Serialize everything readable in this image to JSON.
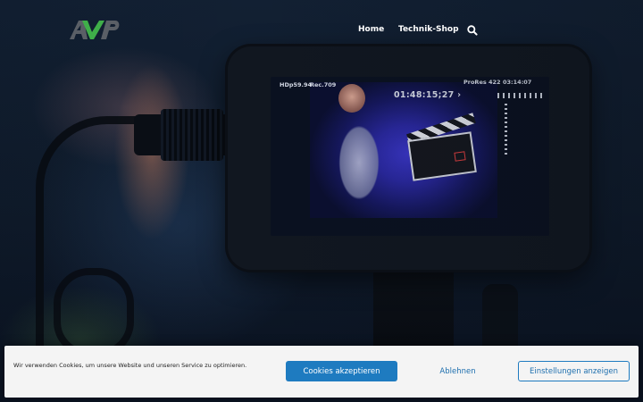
{
  "header": {
    "logo_text": "AVP",
    "logo_colors": {
      "a": "#5a5f66",
      "v": "#3fae49",
      "p": "#5a5f66"
    },
    "nav": [
      {
        "label": "Home"
      },
      {
        "label": "Technik-Shop"
      }
    ],
    "search_icon": "search-icon"
  },
  "hero": {
    "monitor_screen": {
      "format": "HDp59.94",
      "color_space": "Rec.709",
      "timecode": "01:48:15;27 ›",
      "codec": "ProRes 422",
      "battery_time": "03:14:07"
    }
  },
  "cookie_banner": {
    "text": "Wir verwenden Cookies, um unsere Website und unseren Service zu optimieren.",
    "accept_label": "Cookies akzeptieren",
    "reject_label": "Ablehnen",
    "settings_label": "Einstellungen anzeigen",
    "accent_color": "#1e7bc0"
  }
}
